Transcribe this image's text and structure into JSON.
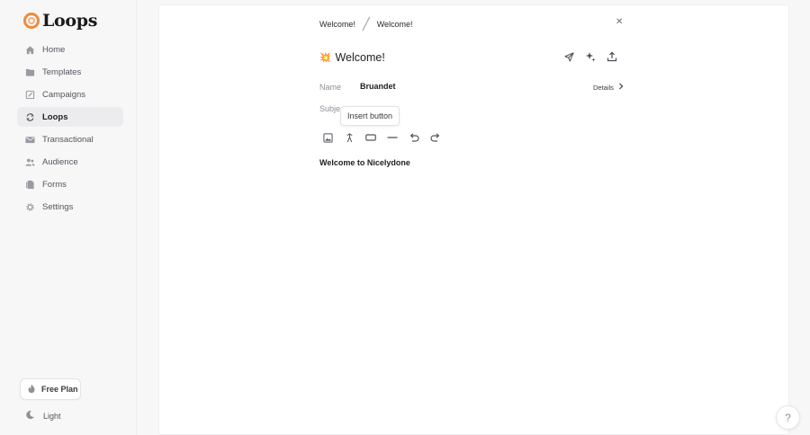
{
  "app": {
    "name": "Loops"
  },
  "sidebar": {
    "items": [
      {
        "label": "Home",
        "icon": "home-icon",
        "active": false
      },
      {
        "label": "Templates",
        "icon": "folder-icon",
        "active": false
      },
      {
        "label": "Campaigns",
        "icon": "pencil-icon",
        "active": false
      },
      {
        "label": "Loops",
        "icon": "refresh-icon",
        "active": true
      },
      {
        "label": "Transactional",
        "icon": "mail-icon",
        "active": false
      },
      {
        "label": "Audience",
        "icon": "users-icon",
        "active": false
      },
      {
        "label": "Forms",
        "icon": "forms-icon",
        "active": false
      },
      {
        "label": "Settings",
        "icon": "gear-icon",
        "active": false
      }
    ],
    "plan_label": "Free Plan",
    "theme_label": "Light"
  },
  "breadcrumb": {
    "first": "Welcome!",
    "second": "Welcome!"
  },
  "editor": {
    "title": "Welcome!",
    "title_emoji": "💥",
    "name_label": "Name",
    "name_value": "Bruandet",
    "subject_label": "Subje",
    "details_label": "Details",
    "tooltip": "Insert button",
    "body": "Welcome to Nicelydone"
  },
  "help": {
    "label": "?"
  },
  "colors": {
    "accent": "#f08a3c",
    "active_bg": "#ececef",
    "page_bg": "#f7f7f8"
  }
}
